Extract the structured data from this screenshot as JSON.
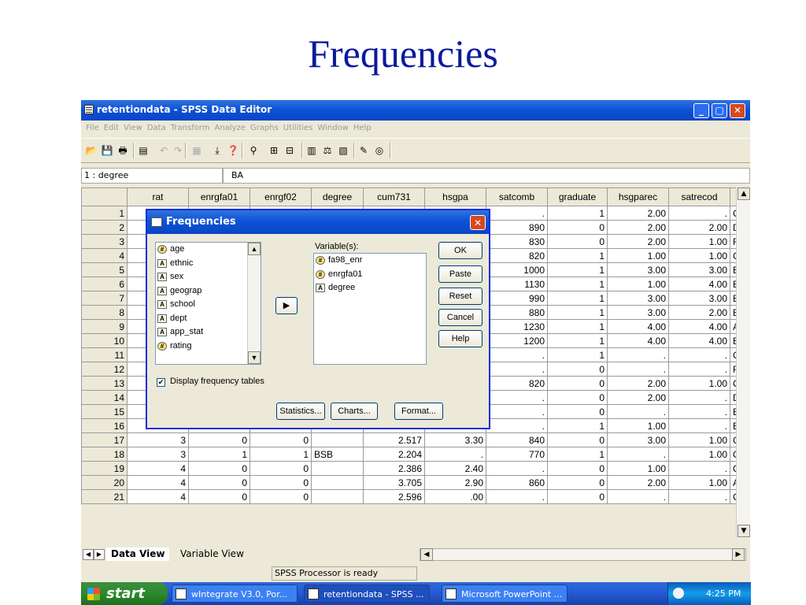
{
  "slide": {
    "title": "Frequencies"
  },
  "window": {
    "title": "retentiondata - SPSS Data Editor",
    "controls": {
      "minimize": "_",
      "maximize": "▢",
      "close": "✕"
    }
  },
  "menu": [
    "File",
    "Edit",
    "View",
    "Data",
    "Transform",
    "Analyze",
    "Graphs",
    "Utilities",
    "Window",
    "Help"
  ],
  "toolbar": {
    "icons": [
      "open-icon",
      "save-icon",
      "print-icon",
      "dialog-recall-icon",
      "undo-icon",
      "redo-icon",
      "goto-chart-icon",
      "goto-case-icon",
      "variables-icon",
      "find-icon",
      "insert-cases-icon",
      "insert-variable-icon",
      "split-file-icon",
      "weight-cases-icon",
      "select-cases-icon",
      "value-labels-icon",
      "use-sets-icon"
    ]
  },
  "cell_editor": {
    "ref": "1 : degree",
    "value": "BA"
  },
  "grid": {
    "columns": [
      "rat",
      "enrgfa01",
      "enrgf02",
      "degree",
      "cum731",
      "hsgpa",
      "satcomb",
      "graduate",
      "hsgparec",
      "satrecod",
      ""
    ],
    "rows": [
      {
        "n": "1",
        "cells": [
          "",
          "",
          "",
          "",
          "",
          "",
          ".",
          "1",
          "2.00",
          ".",
          "C"
        ]
      },
      {
        "n": "2",
        "cells": [
          "",
          "",
          "",
          "",
          "",
          "",
          "890",
          "0",
          "2.00",
          "2.00",
          "D"
        ]
      },
      {
        "n": "3",
        "cells": [
          "",
          "",
          "",
          "",
          "",
          "",
          "830",
          "0",
          "2.00",
          "1.00",
          "F"
        ]
      },
      {
        "n": "4",
        "cells": [
          "",
          "",
          "",
          "",
          "",
          "",
          "820",
          "1",
          "1.00",
          "1.00",
          "C"
        ]
      },
      {
        "n": "5",
        "cells": [
          "",
          "",
          "",
          "",
          "",
          "",
          "1000",
          "1",
          "3.00",
          "3.00",
          "B"
        ]
      },
      {
        "n": "6",
        "cells": [
          "",
          "",
          "",
          "",
          "",
          "",
          "1130",
          "1",
          "1.00",
          "4.00",
          "B"
        ]
      },
      {
        "n": "7",
        "cells": [
          "",
          "",
          "",
          "",
          "",
          "",
          "990",
          "1",
          "3.00",
          "3.00",
          "B"
        ]
      },
      {
        "n": "8",
        "cells": [
          "",
          "",
          "",
          "",
          "",
          "",
          "880",
          "1",
          "3.00",
          "2.00",
          "B"
        ]
      },
      {
        "n": "9",
        "cells": [
          "",
          "",
          "",
          "",
          "",
          "",
          "1230",
          "1",
          "4.00",
          "4.00",
          "A"
        ]
      },
      {
        "n": "10",
        "cells": [
          "",
          "",
          "",
          "",
          "",
          "",
          "1200",
          "1",
          "4.00",
          "4.00",
          "B"
        ]
      },
      {
        "n": "11",
        "cells": [
          "",
          "",
          "",
          "",
          "",
          "",
          ".",
          "1",
          ".",
          ".",
          "C"
        ]
      },
      {
        "n": "12",
        "cells": [
          "",
          "",
          "",
          "",
          "",
          "",
          ".",
          "0",
          ".",
          ".",
          "F"
        ]
      },
      {
        "n": "13",
        "cells": [
          "",
          "",
          "",
          "",
          "",
          "",
          "820",
          "0",
          "2.00",
          "1.00",
          "C"
        ]
      },
      {
        "n": "14",
        "cells": [
          "",
          "",
          "",
          "",
          "",
          "",
          ".",
          "0",
          "2.00",
          ".",
          "D"
        ]
      },
      {
        "n": "15",
        "cells": [
          "1",
          "0",
          "0",
          "",
          "3.233",
          ".00",
          ".",
          "0",
          ".",
          ".",
          "B"
        ]
      },
      {
        "n": "16",
        "cells": [
          "1",
          "1",
          "1",
          "BSB",
          "3.464",
          "2.20",
          ".",
          "1",
          "1.00",
          ".",
          "B"
        ]
      },
      {
        "n": "17",
        "cells": [
          "3",
          "0",
          "0",
          "",
          "2.517",
          "3.30",
          "840",
          "0",
          "3.00",
          "1.00",
          "C"
        ]
      },
      {
        "n": "18",
        "cells": [
          "3",
          "1",
          "1",
          "BSB",
          "2.204",
          ".",
          "770",
          "1",
          ".",
          "1.00",
          "C"
        ]
      },
      {
        "n": "19",
        "cells": [
          "4",
          "0",
          "0",
          "",
          "2.386",
          "2.40",
          ".",
          "0",
          "1.00",
          ".",
          "C"
        ]
      },
      {
        "n": "20",
        "cells": [
          "4",
          "0",
          "0",
          "",
          "3.705",
          "2.90",
          "860",
          "0",
          "2.00",
          "1.00",
          "A"
        ]
      },
      {
        "n": "21",
        "cells": [
          "4",
          "0",
          "0",
          "",
          "2.596",
          ".00",
          ".",
          "0",
          ".",
          ".",
          "C"
        ]
      }
    ]
  },
  "tabs": {
    "data_view": "Data View",
    "variable_view": "Variable View"
  },
  "status": {
    "message": "SPSS Processor  is ready"
  },
  "dialog": {
    "title": "Frequencies",
    "source_vars": [
      {
        "name": "age",
        "type": "numeric"
      },
      {
        "name": "ethnic",
        "type": "string"
      },
      {
        "name": "sex",
        "type": "string"
      },
      {
        "name": "geograp",
        "type": "string"
      },
      {
        "name": "school",
        "type": "string"
      },
      {
        "name": "dept",
        "type": "string"
      },
      {
        "name": "app_stat",
        "type": "string"
      },
      {
        "name": "rating",
        "type": "numeric"
      }
    ],
    "variables_label": "Variable(s):",
    "selected_vars": [
      {
        "name": "fa98_enr",
        "type": "numeric"
      },
      {
        "name": "enrgfa01",
        "type": "numeric"
      },
      {
        "name": "degree",
        "type": "string"
      }
    ],
    "buttons": {
      "ok": "OK",
      "paste": "Paste",
      "reset": "Reset",
      "cancel": "Cancel",
      "help": "Help",
      "statistics": "Statistics...",
      "charts": "Charts...",
      "format": "Format..."
    },
    "display_tables_label": "Display frequency tables",
    "display_tables_checked": true
  },
  "taskbar": {
    "start": "start",
    "items": [
      {
        "label": "wIntegrate V3.0, Por...",
        "active": false
      },
      {
        "label": "retentiondata - SPSS ...",
        "active": true
      },
      {
        "label": "Microsoft PowerPoint ...",
        "active": false
      }
    ],
    "clock": "4:25 PM"
  }
}
